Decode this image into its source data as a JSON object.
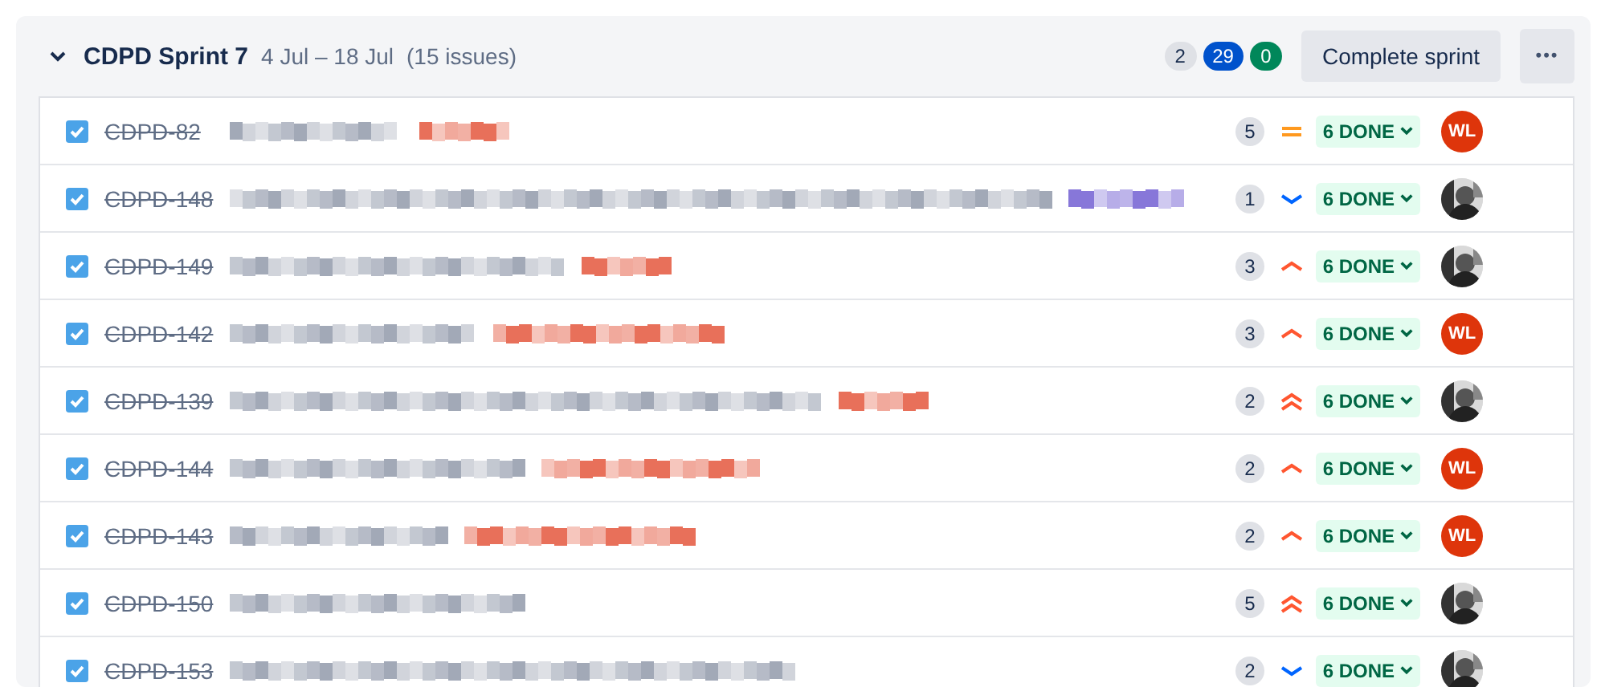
{
  "sprint": {
    "expanded": true,
    "name": "CDPD Sprint 7",
    "dates": "4 Jul – 18 Jul",
    "count": "(15 issues)",
    "badges": [
      {
        "label": "2",
        "color": "#dfe1e6"
      },
      {
        "label": "29",
        "color": "#0052cc"
      },
      {
        "label": "0",
        "color": "#00875a"
      }
    ],
    "complete_button": "Complete sprint",
    "more_button": "•••"
  },
  "issues": [
    {
      "key": "CDPD-82",
      "done": true,
      "points": "5",
      "priority": {
        "kind": "medium"
      },
      "status": "6 DONE",
      "epic": {
        "color": "#e8705a"
      },
      "avatar": {
        "kind": "initials",
        "initials": "WL"
      }
    },
    {
      "key": "CDPD-148",
      "done": true,
      "points": "1",
      "priority": {
        "kind": "low"
      },
      "status": "6 DONE",
      "epic": {
        "color": "#8777d9"
      }
    },
    {
      "key": "CDPD-149",
      "done": true,
      "points": "3",
      "priority": {
        "kind": "high"
      },
      "status": "6 DONE",
      "epic": {
        "color": "#e8705a"
      }
    },
    {
      "key": "CDPD-142",
      "done": true,
      "points": "3",
      "priority": {
        "kind": "high"
      },
      "status": "6 DONE",
      "epic": {
        "color": "#e8705a"
      },
      "avatar": {
        "kind": "initials",
        "initials": "WL"
      }
    },
    {
      "key": "CDPD-139",
      "done": true,
      "points": "2",
      "priority": {
        "kind": "highest"
      },
      "status": "6 DONE",
      "epic": {
        "color": "#e8705a"
      }
    },
    {
      "key": "CDPD-144",
      "done": true,
      "points": "2",
      "priority": {
        "kind": "high"
      },
      "status": "6 DONE",
      "epic": {
        "color": "#e8705a"
      },
      "avatar": {
        "kind": "initials",
        "initials": "WL"
      }
    },
    {
      "key": "CDPD-143",
      "done": true,
      "points": "2",
      "priority": {
        "kind": "high"
      },
      "status": "6 DONE",
      "epic": {
        "color": "#e8705a"
      },
      "avatar": {
        "kind": "initials",
        "initials": "WL"
      }
    },
    {
      "key": "CDPD-150",
      "done": true,
      "points": "5",
      "priority": {
        "kind": "highest"
      },
      "status": "6 DONE"
    },
    {
      "key": "CDPD-153",
      "done": true,
      "points": "2",
      "priority": {
        "kind": "low"
      },
      "status": "6 DONE"
    }
  ]
}
